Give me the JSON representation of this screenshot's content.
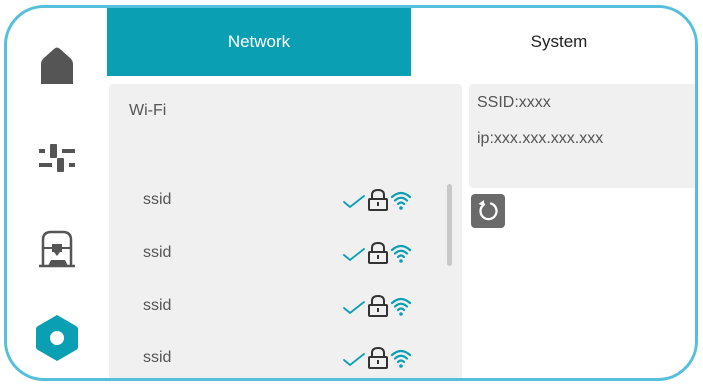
{
  "sidebar": {
    "items": [
      {
        "name": "home",
        "icon": "home-icon"
      },
      {
        "name": "controls",
        "icon": "sliders-icon"
      },
      {
        "name": "printer",
        "icon": "printer-icon"
      },
      {
        "name": "settings",
        "icon": "hexagon-settings-icon",
        "active": true
      }
    ]
  },
  "tabs": {
    "network": "Network",
    "system": "System",
    "active": "network"
  },
  "wifi": {
    "title": "Wi-Fi",
    "networks": [
      {
        "ssid": "ssid",
        "connected": true,
        "locked": true
      },
      {
        "ssid": "ssid",
        "connected": true,
        "locked": true
      },
      {
        "ssid": "ssid",
        "connected": true,
        "locked": true
      },
      {
        "ssid": "ssid",
        "connected": true,
        "locked": true
      }
    ]
  },
  "info": {
    "ssid": "SSID:xxxx",
    "ip": "ip:xxx.xxx.xxx.xxx"
  },
  "refresh": {
    "icon": "refresh-icon"
  },
  "colors": {
    "accent": "#0a9fb3",
    "border": "#56c0da",
    "icon_dark": "#555555",
    "panel_bg": "#f0f0f0"
  }
}
